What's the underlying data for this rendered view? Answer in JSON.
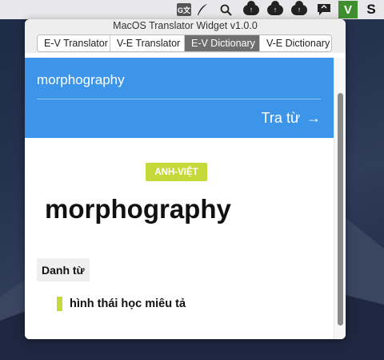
{
  "menubar": {
    "icons": [
      "google-translate-icon",
      "quill-icon",
      "search-icon",
      "cloud-upload-icon",
      "cloud-upload-icon",
      "cloud-upload-icon",
      "speech-bubble-icon",
      "vocabulary-v-icon",
      "s-icon"
    ],
    "gt_glyph": "G文",
    "v_label": "V",
    "s_label": "S",
    "accent": "#3f8f2f"
  },
  "window": {
    "title": "MacOS Translator Widget v1.0.0"
  },
  "tabs": [
    {
      "label": "E-V Translator",
      "active": false
    },
    {
      "label": "V-E Translator",
      "active": false
    },
    {
      "label": "E-V Dictionary",
      "active": true
    },
    {
      "label": "V-E Dictionary",
      "active": false
    }
  ],
  "search": {
    "query": "morphography",
    "button_label": "Tra từ",
    "button_arrow": "→",
    "panel_color": "#3d95ea"
  },
  "result": {
    "badge": "ANH-VIỆT",
    "badge_color": "#c6d93a",
    "headword": "morphography",
    "part_of_speech": "Danh từ",
    "senses": [
      "hình thái học miêu tả"
    ]
  }
}
